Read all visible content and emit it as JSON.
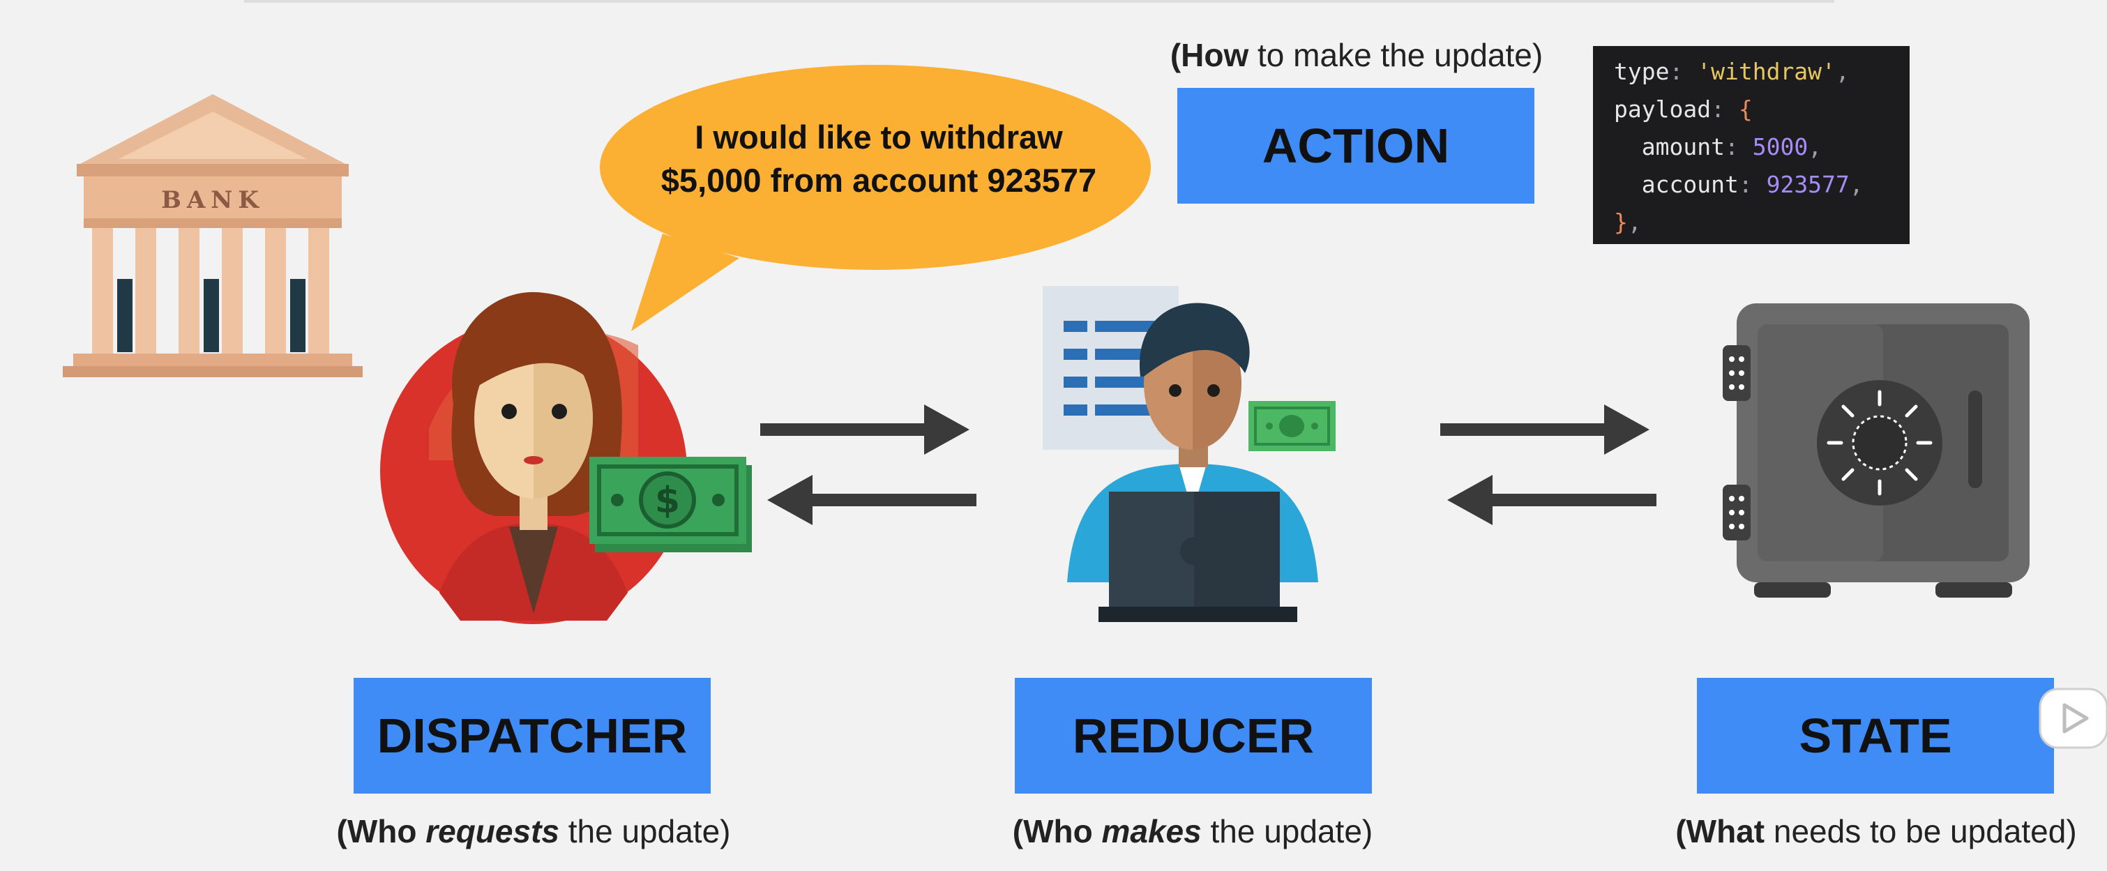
{
  "speech_bubble": {
    "line1": "I would like to withdraw",
    "line2": "$5,000 from account 923577"
  },
  "bank_sign": "BANK",
  "action": {
    "caption_bold": "How",
    "caption_rest": " to make the update)",
    "caption_open": "(",
    "label": "ACTION"
  },
  "code": {
    "type_key": "type",
    "type_val": "'withdraw'",
    "payload_key": "payload",
    "amount_key": "amount",
    "amount_val": "5000",
    "account_key": "account",
    "account_val": "923577"
  },
  "dispatcher": {
    "label": "DISPATCHER",
    "cap_open": "(Who ",
    "cap_em": "requests",
    "cap_rest": " the update)"
  },
  "reducer": {
    "label": "REDUCER",
    "cap_open": "(Who ",
    "cap_em": "makes",
    "cap_rest": " the update)"
  },
  "state": {
    "label": "STATE",
    "cap_bold": "(What",
    "cap_rest": " needs to be updated)"
  },
  "colors": {
    "box_blue": "#3f8cf7",
    "bubble": "#fbb033",
    "arrow": "#3a3a3a"
  }
}
